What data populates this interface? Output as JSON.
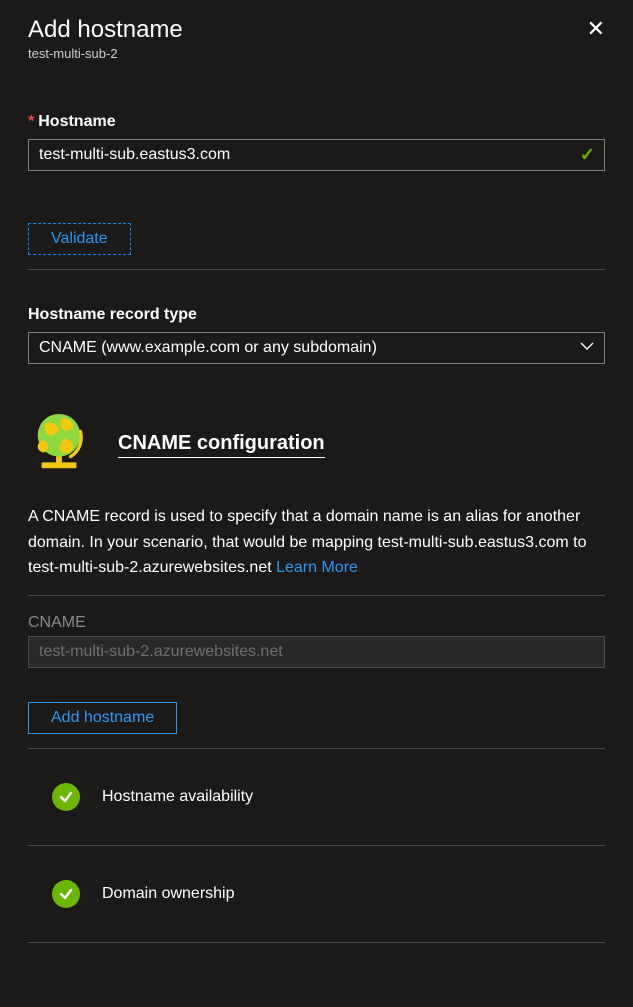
{
  "header": {
    "title": "Add hostname",
    "subtitle": "test-multi-sub-2"
  },
  "hostname": {
    "label": "Hostname",
    "value": "test-multi-sub.eastus3.com"
  },
  "buttons": {
    "validate": "Validate",
    "add_hostname": "Add hostname"
  },
  "record_type": {
    "label": "Hostname record type",
    "selected": "CNAME (www.example.com or any subdomain)"
  },
  "config": {
    "title": "CNAME configuration",
    "description": "A CNAME record is used to specify that a domain name is an alias for another domain. In your scenario, that would be mapping test-multi-sub.eastus3.com to test-multi-sub-2.azurewebsites.net ",
    "learn_more": "Learn More"
  },
  "cname_field": {
    "label": "CNAME",
    "value": "test-multi-sub-2.azurewebsites.net"
  },
  "status": {
    "availability": "Hostname availability",
    "ownership": "Domain ownership"
  }
}
